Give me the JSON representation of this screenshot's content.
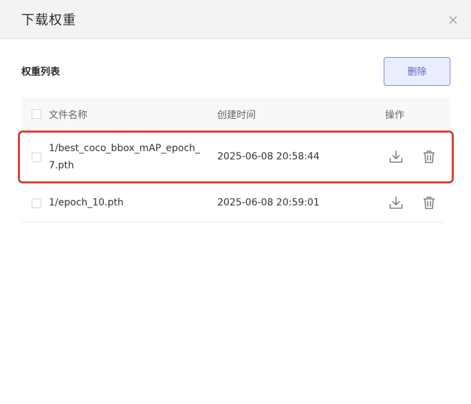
{
  "modal": {
    "title": "下载权重",
    "close_icon": "close-icon"
  },
  "toolbar": {
    "section_title": "权重列表",
    "delete_label": "删除"
  },
  "table": {
    "columns": [
      "文件名称",
      "创建时间",
      "操作"
    ],
    "rows": [
      {
        "name_line1": "1/best_coco_bbox_mAP_epoch_",
        "name_line2": "7.pth",
        "created": "2025-06-08 20:58:44",
        "actions": [
          "download-icon",
          "trash-icon"
        ],
        "highlighted": true
      },
      {
        "name_line1": "1/epoch_10.pth",
        "created": "2025-06-08 20:59:01",
        "actions": [
          "download-icon",
          "trash-icon"
        ],
        "highlighted": false
      }
    ]
  },
  "colors": {
    "header_bg": "#f3f3f5",
    "accent": "#5b66c9",
    "highlight_border": "#d9412d"
  }
}
